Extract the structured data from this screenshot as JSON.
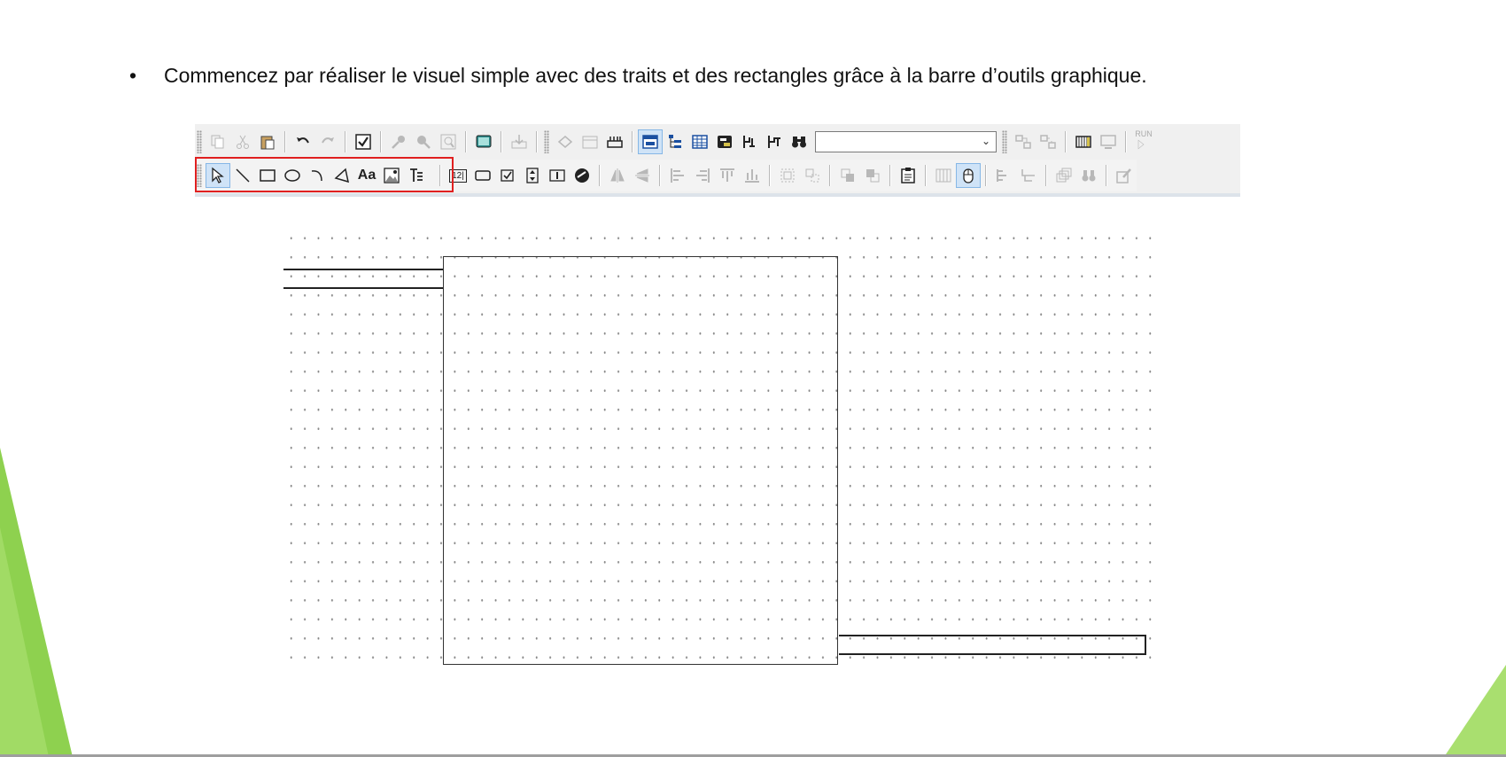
{
  "slide": {
    "bullet": "•",
    "instruction": "Commencez par réaliser le visuel simple avec des traits et des rectangles grâce à la barre d’outils graphique."
  },
  "toolbar": {
    "row1_buttons": [
      "copy-icon",
      "cut-icon",
      "paste-icon",
      "undo-icon",
      "redo-icon",
      "check-icon",
      "key-icon",
      "find-icon",
      "zoom-icon",
      "screen-icon",
      "export-icon",
      "print-icon",
      "calendar-icon",
      "ruler-icon",
      "window-icon",
      "tree-icon",
      "table-icon",
      "database-icon",
      "variable-in-icon",
      "variable-out-icon",
      "binoculars-icon"
    ],
    "combo_value": "",
    "run_label": "RUN",
    "row2_draw_tools": [
      "select-arrow-icon",
      "line-icon",
      "rectangle-icon",
      "ellipse-icon",
      "arc-icon",
      "polygon-icon",
      "text-icon",
      "image-icon",
      "text-block-icon"
    ],
    "text_tool_label": "Aa",
    "number_tool_label": "12|"
  },
  "colors": {
    "highlight_border": "#e02020",
    "accent_green": "#8ed14f",
    "active_tool_bg": "#cfe3f7"
  }
}
